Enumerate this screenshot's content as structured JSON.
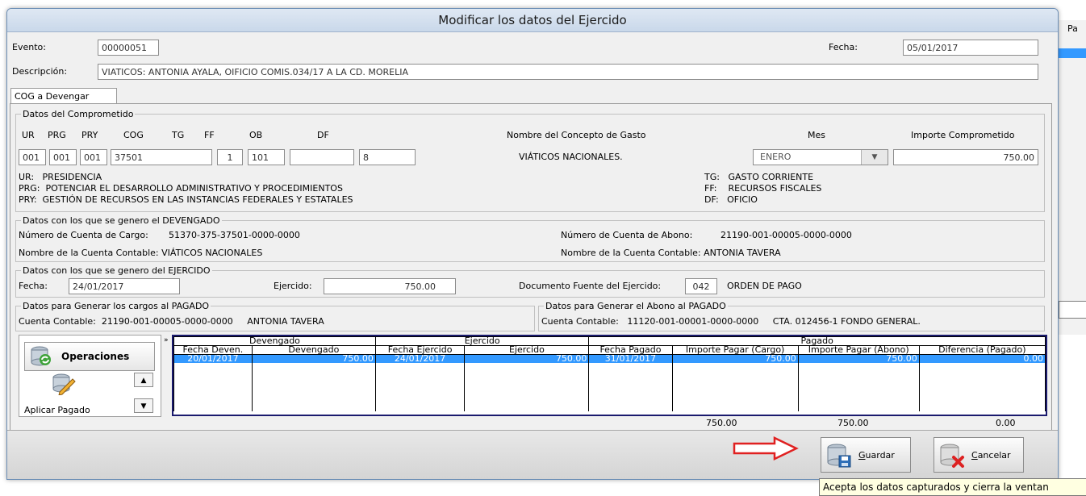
{
  "background": {
    "right_header": "Pa"
  },
  "tooltip": "Acepta los datos capturados y cierra la ventan",
  "dialog": {
    "title": "Modificar los datos del Ejercido",
    "evento": {
      "label": "Evento:",
      "value": "00000051"
    },
    "fecha": {
      "label": "Fecha:",
      "value": "05/01/2017"
    },
    "descripcion": {
      "label": "Descripción:",
      "value": "VIATICOS: ANTONIA AYALA, OIFICIO COMIS.034/17 A LA CD. MORELIA"
    },
    "tab": "COG a Devengar"
  },
  "comprometido": {
    "legend": "Datos del Comprometido",
    "headers": {
      "ur": "UR",
      "prg": "PRG",
      "pry": "PRY",
      "cog": "COG",
      "tg": "TG",
      "ff": "FF",
      "ob": "OB",
      "df": "DF",
      "concepto": "Nombre del Concepto de Gasto",
      "mes": "Mes",
      "importe": "Importe Comprometido"
    },
    "values": {
      "ur": "001",
      "prg": "001",
      "pry": "001",
      "cog": "37501",
      "tg": "1",
      "ff": "101",
      "ob": "",
      "df": "8",
      "concepto": "VIÁTICOS NACIONALES.",
      "mes": "ENERO",
      "importe": "750.00"
    },
    "ur_line": "UR:   PRESIDENCIA",
    "prg_line": "PRG:  POTENCIAR EL DESARROLLO ADMINISTRATIVO Y PROCEDIMIENTOS",
    "pry_line": "PRY:  GESTIÓN DE RECURSOS EN LAS INSTANCIAS FEDERALES Y ESTATALES",
    "tg_line": "TG:   GASTO CORRIENTE",
    "ff_line": "FF:    RECURSOS FISCALES",
    "df_line": "DF:   OFICIO"
  },
  "devengado": {
    "legend": "Datos con los que se genero el DEVENGADO",
    "cargo_label": "Número de Cuenta de Cargo:",
    "cargo_value": "51370-375-37501-0000-0000",
    "cargo_nombre": "Nombre de la Cuenta Contable: VIÁTICOS NACIONALES",
    "abono_label": "Número de Cuenta de Abono:",
    "abono_value": "21190-001-00005-0000-0000",
    "abono_nombre": "Nombre de la Cuenta Contable: ANTONIA TAVERA"
  },
  "ejercido": {
    "legend": "Datos con los que se genero del EJERCIDO",
    "fecha_label": "Fecha:",
    "fecha_value": "24/01/2017",
    "ejercido_label": "Ejercido:",
    "ejercido_value": "750.00",
    "doc_label": "Documento Fuente del Ejercido:",
    "doc_value": "042",
    "doc_text": "ORDEN DE PAGO"
  },
  "pagado_cargos": {
    "legend": "Datos para Generar los cargos al PAGADO",
    "text": "Cuenta Contable:  21190-001-00005-0000-0000     ANTONIA TAVERA"
  },
  "pagado_abono": {
    "legend": "Datos para Generar el Abono al PAGADO",
    "text": "Cuenta Contable:   11120-001-00001-0000-0000     CTA. 012456-1 FONDO GENERAL."
  },
  "operaciones": {
    "button": "Operaciones",
    "aplicar": "Aplicar Pagado",
    "collapse": "»"
  },
  "grid": {
    "groups": [
      "Devengado",
      "Ejercido",
      "Pagado"
    ],
    "columns": [
      "Fecha Deven.",
      "Devengado",
      "Fecha Ejercido",
      "Ejercido",
      "Fecha Pagado",
      "Importe Pagar (Cargo)",
      "Importe Pagar (Abono)",
      "Diferencia (Pagado)"
    ],
    "row": [
      "20/01/2017",
      "750.00",
      "24/01/2017",
      "750.00",
      "31/01/2017",
      "750.00",
      "750.00",
      "0.00"
    ],
    "totals": [
      "750.00",
      "750.00",
      "0.00"
    ]
  },
  "buttons": {
    "guardar": "Guardar",
    "cancelar": "Cancelar"
  }
}
